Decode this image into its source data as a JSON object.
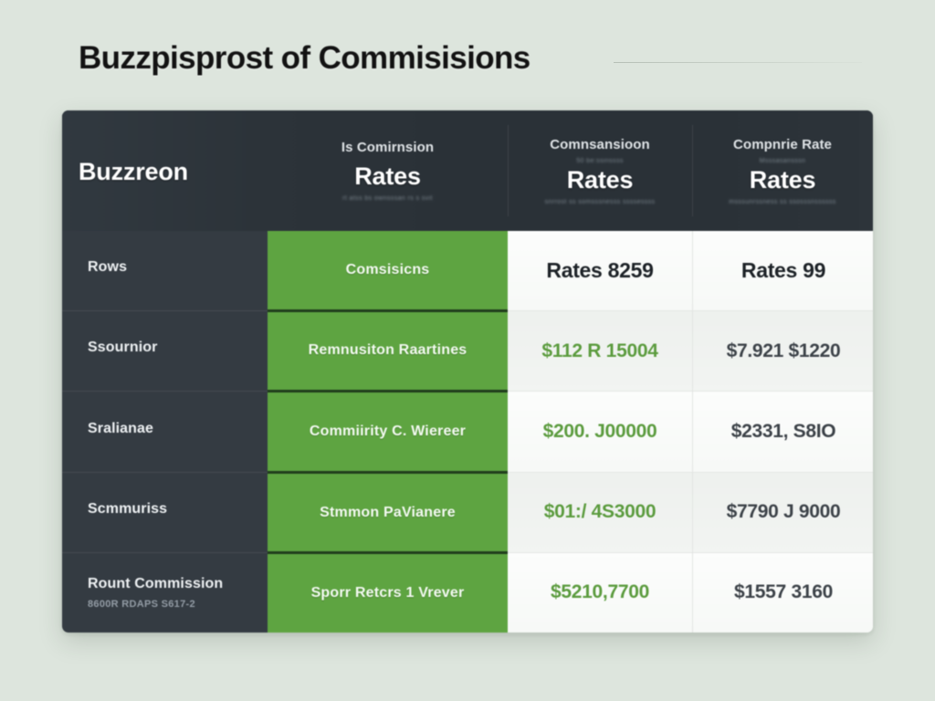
{
  "page": {
    "title": "Buzzpisprost of Commisisions",
    "background_color": "#dde5dd"
  },
  "colors": {
    "header_dark": "#2b3238",
    "label_dark": "#343b42",
    "accent_green": "#5ea441",
    "green_divider": "#203d1c",
    "value_green_text": "#5b9b3e",
    "value_dark_text": "#3c4248",
    "row_alt": "#eef1ee"
  },
  "table": {
    "header": [
      {
        "id": "col-buzzreon",
        "eyebrow": "",
        "micro_top": "",
        "main": "Buzzreon",
        "micro_bottom": ""
      },
      {
        "id": "col-commission-rates",
        "eyebrow": "Is Comirnsion",
        "micro_top": "",
        "main": "Rates",
        "micro_bottom": "rt atss bs ownsssan rs s svit"
      },
      {
        "id": "col-comnsansioon-rates",
        "eyebrow": "Comnsansioon",
        "micro_top": "50 be:ssinssss",
        "main": "Rates",
        "micro_bottom": "snrrost ss somsssnesss ssssessss"
      },
      {
        "id": "col-compnrie-rate",
        "eyebrow": "Compnrie Rate",
        "micro_top": "Msssasansssn",
        "main": "Rates",
        "micro_bottom": "msssunrssness ss ssosssnssssss"
      }
    ],
    "rows": [
      {
        "label": "Rows",
        "sublabel": "",
        "green": "Comsisicns",
        "value_a": "Rates 8259",
        "value_b": "Rates 99",
        "value_a_style": "head",
        "value_b_style": "head"
      },
      {
        "label": "Ssournior",
        "sublabel": "",
        "green": "Remnusiton Raartines",
        "value_a": "$112 R 15004",
        "value_b": "$7.921 $1220",
        "value_a_style": "green",
        "value_b_style": "dark"
      },
      {
        "label": "Sralianae",
        "sublabel": "",
        "green": "Commiirity C. Wiereer",
        "value_a": "$200. J00000",
        "value_b": "$2331, S8IO",
        "value_a_style": "green",
        "value_b_style": "dark"
      },
      {
        "label": "Scmmuriss",
        "sublabel": "",
        "green": "Stmmon PaVianere",
        "value_a": "$01:/ 4S3000",
        "value_b": "$7790 J 9000",
        "value_a_style": "green",
        "value_b_style": "dark"
      },
      {
        "label": "Rount Commission",
        "sublabel": "8600R RDAPS S617-2",
        "green": "Sporr Retcrs 1 Vrever",
        "value_a": "$5210,7700",
        "value_b": "$1557 3160",
        "value_a_style": "green",
        "value_b_style": "dark"
      }
    ]
  }
}
